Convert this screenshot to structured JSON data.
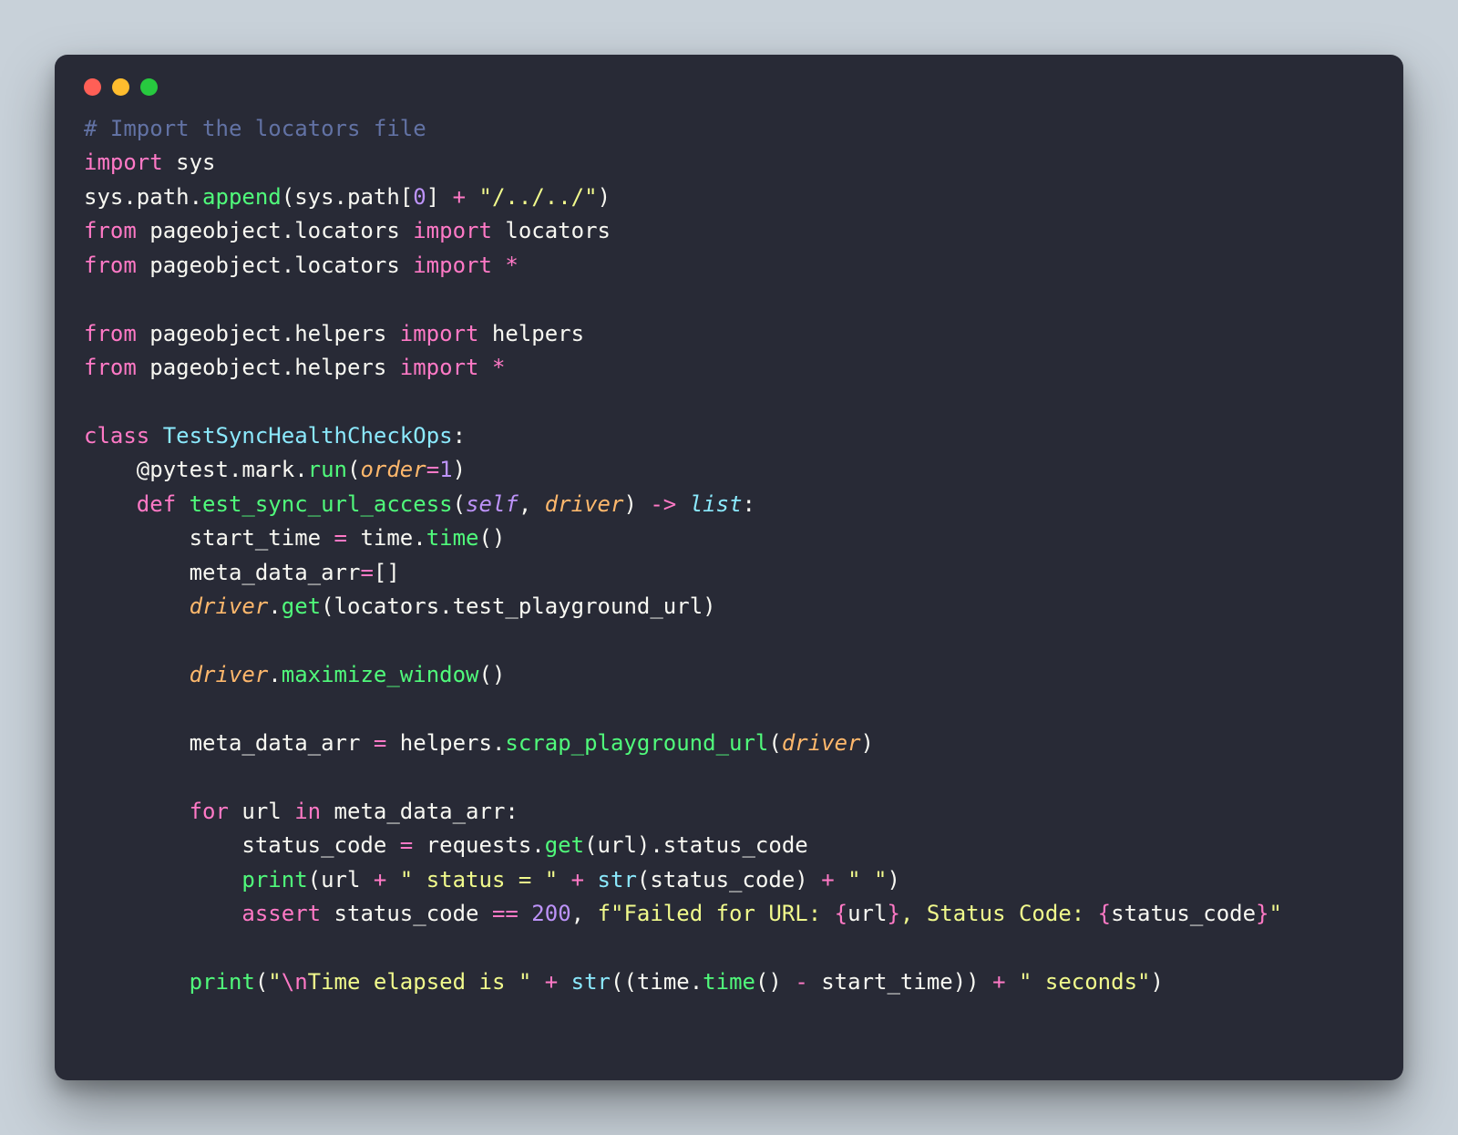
{
  "window": {
    "traffic": [
      "red",
      "yellow",
      "green"
    ]
  },
  "theme": {
    "background": "#282a36",
    "page_background": "#c8d1d9",
    "comment": "#6272a4",
    "keyword": "#ff79c6",
    "identifier": "#f8f8f2",
    "function": "#50fa7b",
    "class": "#8be9fd",
    "param": "#ffb86c",
    "builtin": "#8be9fd",
    "number": "#bd93f9",
    "string": "#f1fa8c",
    "self": "#bd93f9"
  },
  "code": {
    "language": "python",
    "tokens": [
      [
        {
          "t": "# Import the locators file",
          "c": "comment"
        }
      ],
      [
        {
          "t": "import",
          "c": "kw"
        },
        {
          "t": " sys",
          "c": "ident"
        }
      ],
      [
        {
          "t": "sys.path.",
          "c": "ident"
        },
        {
          "t": "append",
          "c": "func"
        },
        {
          "t": "(sys.path[",
          "c": "punc"
        },
        {
          "t": "0",
          "c": "num"
        },
        {
          "t": "] ",
          "c": "punc"
        },
        {
          "t": "+",
          "c": "op"
        },
        {
          "t": " ",
          "c": "punc"
        },
        {
          "t": "\"/../../\"",
          "c": "str"
        },
        {
          "t": ")",
          "c": "punc"
        }
      ],
      [
        {
          "t": "from",
          "c": "kw"
        },
        {
          "t": " pageobject.locators ",
          "c": "ident"
        },
        {
          "t": "import",
          "c": "kw"
        },
        {
          "t": " locators",
          "c": "ident"
        }
      ],
      [
        {
          "t": "from",
          "c": "kw"
        },
        {
          "t": " pageobject.locators ",
          "c": "ident"
        },
        {
          "t": "import",
          "c": "kw"
        },
        {
          "t": " ",
          "c": "ident"
        },
        {
          "t": "*",
          "c": "op"
        }
      ],
      [],
      [
        {
          "t": "from",
          "c": "kw"
        },
        {
          "t": " pageobject.helpers ",
          "c": "ident"
        },
        {
          "t": "import",
          "c": "kw"
        },
        {
          "t": " helpers",
          "c": "ident"
        }
      ],
      [
        {
          "t": "from",
          "c": "kw"
        },
        {
          "t": " pageobject.helpers ",
          "c": "ident"
        },
        {
          "t": "import",
          "c": "kw"
        },
        {
          "t": " ",
          "c": "ident"
        },
        {
          "t": "*",
          "c": "op"
        }
      ],
      [],
      [
        {
          "t": "class",
          "c": "kw"
        },
        {
          "t": " ",
          "c": "ident"
        },
        {
          "t": "TestSyncHealthCheckOps",
          "c": "class"
        },
        {
          "t": ":",
          "c": "punc"
        }
      ],
      [
        {
          "t": "    @pytest.mark.",
          "c": "ident"
        },
        {
          "t": "run",
          "c": "func"
        },
        {
          "t": "(",
          "c": "punc"
        },
        {
          "t": "order",
          "c": "paramit"
        },
        {
          "t": "=",
          "c": "op"
        },
        {
          "t": "1",
          "c": "num"
        },
        {
          "t": ")",
          "c": "punc"
        }
      ],
      [
        {
          "t": "    ",
          "c": "ident"
        },
        {
          "t": "def",
          "c": "kw"
        },
        {
          "t": " ",
          "c": "ident"
        },
        {
          "t": "test_sync_url_access",
          "c": "func"
        },
        {
          "t": "(",
          "c": "punc"
        },
        {
          "t": "self",
          "c": "self"
        },
        {
          "t": ", ",
          "c": "punc"
        },
        {
          "t": "driver",
          "c": "paramit"
        },
        {
          "t": ") ",
          "c": "punc"
        },
        {
          "t": "->",
          "c": "op"
        },
        {
          "t": " ",
          "c": "punc"
        },
        {
          "t": "list",
          "c": "type"
        },
        {
          "t": ":",
          "c": "punc"
        }
      ],
      [
        {
          "t": "        start_time ",
          "c": "ident"
        },
        {
          "t": "=",
          "c": "op"
        },
        {
          "t": " time.",
          "c": "ident"
        },
        {
          "t": "time",
          "c": "func"
        },
        {
          "t": "()",
          "c": "punc"
        }
      ],
      [
        {
          "t": "        meta_data_arr",
          "c": "ident"
        },
        {
          "t": "=",
          "c": "op"
        },
        {
          "t": "[]",
          "c": "punc"
        }
      ],
      [
        {
          "t": "        ",
          "c": "ident"
        },
        {
          "t": "driver",
          "c": "paramit"
        },
        {
          "t": ".",
          "c": "punc"
        },
        {
          "t": "get",
          "c": "func"
        },
        {
          "t": "(locators.test_playground_url)",
          "c": "punc"
        }
      ],
      [],
      [
        {
          "t": "        ",
          "c": "ident"
        },
        {
          "t": "driver",
          "c": "paramit"
        },
        {
          "t": ".",
          "c": "punc"
        },
        {
          "t": "maximize_window",
          "c": "func"
        },
        {
          "t": "()",
          "c": "punc"
        }
      ],
      [],
      [
        {
          "t": "        meta_data_arr ",
          "c": "ident"
        },
        {
          "t": "=",
          "c": "op"
        },
        {
          "t": " helpers.",
          "c": "ident"
        },
        {
          "t": "scrap_playground_url",
          "c": "func"
        },
        {
          "t": "(",
          "c": "punc"
        },
        {
          "t": "driver",
          "c": "paramit"
        },
        {
          "t": ")",
          "c": "punc"
        }
      ],
      [],
      [
        {
          "t": "        ",
          "c": "ident"
        },
        {
          "t": "for",
          "c": "kw"
        },
        {
          "t": " url ",
          "c": "ident"
        },
        {
          "t": "in",
          "c": "kw"
        },
        {
          "t": " meta_data_arr:",
          "c": "ident"
        }
      ],
      [
        {
          "t": "            status_code ",
          "c": "ident"
        },
        {
          "t": "=",
          "c": "op"
        },
        {
          "t": " requests.",
          "c": "ident"
        },
        {
          "t": "get",
          "c": "func"
        },
        {
          "t": "(url).status_code",
          "c": "punc"
        }
      ],
      [
        {
          "t": "            ",
          "c": "ident"
        },
        {
          "t": "print",
          "c": "func"
        },
        {
          "t": "(url ",
          "c": "punc"
        },
        {
          "t": "+",
          "c": "op"
        },
        {
          "t": " ",
          "c": "punc"
        },
        {
          "t": "\" status = \"",
          "c": "str"
        },
        {
          "t": " ",
          "c": "punc"
        },
        {
          "t": "+",
          "c": "op"
        },
        {
          "t": " ",
          "c": "punc"
        },
        {
          "t": "str",
          "c": "builtin"
        },
        {
          "t": "(status_code) ",
          "c": "punc"
        },
        {
          "t": "+",
          "c": "op"
        },
        {
          "t": " ",
          "c": "punc"
        },
        {
          "t": "\" \"",
          "c": "str"
        },
        {
          "t": ")",
          "c": "punc"
        }
      ],
      [
        {
          "t": "            ",
          "c": "ident"
        },
        {
          "t": "assert",
          "c": "kw"
        },
        {
          "t": " status_code ",
          "c": "ident"
        },
        {
          "t": "==",
          "c": "op"
        },
        {
          "t": " ",
          "c": "punc"
        },
        {
          "t": "200",
          "c": "num"
        },
        {
          "t": ", ",
          "c": "punc"
        },
        {
          "t": "f\"Failed for URL: ",
          "c": "str"
        },
        {
          "t": "{",
          "c": "strbrace"
        },
        {
          "t": "url",
          "c": "ident"
        },
        {
          "t": "}",
          "c": "strbrace"
        },
        {
          "t": ", Status Code: ",
          "c": "str"
        },
        {
          "t": "{",
          "c": "strbrace"
        },
        {
          "t": "status_code",
          "c": "ident"
        },
        {
          "t": "}",
          "c": "strbrace"
        },
        {
          "t": "\"",
          "c": "str"
        }
      ],
      [],
      [
        {
          "t": "        ",
          "c": "ident"
        },
        {
          "t": "print",
          "c": "func"
        },
        {
          "t": "(",
          "c": "punc"
        },
        {
          "t": "\"",
          "c": "str"
        },
        {
          "t": "\\n",
          "c": "strbrace"
        },
        {
          "t": "Time elapsed is \"",
          "c": "str"
        },
        {
          "t": " ",
          "c": "punc"
        },
        {
          "t": "+",
          "c": "op"
        },
        {
          "t": " ",
          "c": "punc"
        },
        {
          "t": "str",
          "c": "builtin"
        },
        {
          "t": "((time.",
          "c": "punc"
        },
        {
          "t": "time",
          "c": "func"
        },
        {
          "t": "() ",
          "c": "punc"
        },
        {
          "t": "-",
          "c": "op"
        },
        {
          "t": " start_time)) ",
          "c": "punc"
        },
        {
          "t": "+",
          "c": "op"
        },
        {
          "t": " ",
          "c": "punc"
        },
        {
          "t": "\" seconds\"",
          "c": "str"
        },
        {
          "t": ")",
          "c": "punc"
        }
      ]
    ]
  }
}
